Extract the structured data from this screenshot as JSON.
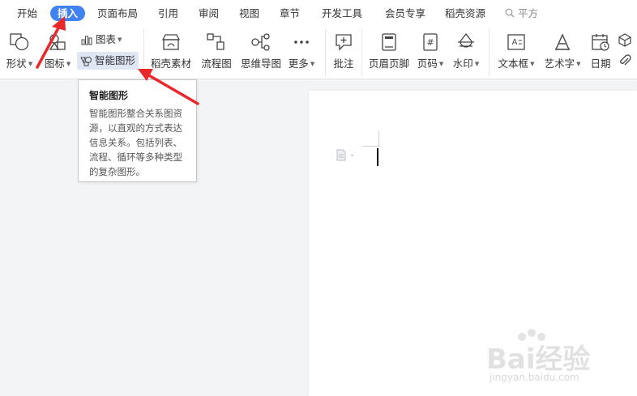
{
  "menu": {
    "items": [
      "开始",
      "插入",
      "页面布局",
      "引用",
      "审阅",
      "视图",
      "章节",
      "开发工具",
      "会员专享",
      "稻壳资源"
    ],
    "active_index": 1,
    "search_text": "平方"
  },
  "ribbon": {
    "shape": "形状",
    "icon": "图标",
    "chart": "图表",
    "smart_art": "智能图形",
    "docer_material": "稻壳素材",
    "flowchart": "流程图",
    "mindmap": "思维导图",
    "more": "更多",
    "comment": "批注",
    "header_footer": "页眉页脚",
    "page_number": "页码",
    "watermark": "水印",
    "textbox": "文本框",
    "wordart": "艺术字",
    "date": "日期"
  },
  "tooltip": {
    "title": "智能图形",
    "body": "智能图形整合关系图资源，以直观的方式表达信息关系。包括列表、流程、循环等多种类型的复杂图形。"
  },
  "watermark": {
    "text": "Bai经验",
    "url": "jingyan.baidu.com"
  },
  "colors": {
    "accent": "#3f82f0",
    "arrow": "#e8282b"
  }
}
